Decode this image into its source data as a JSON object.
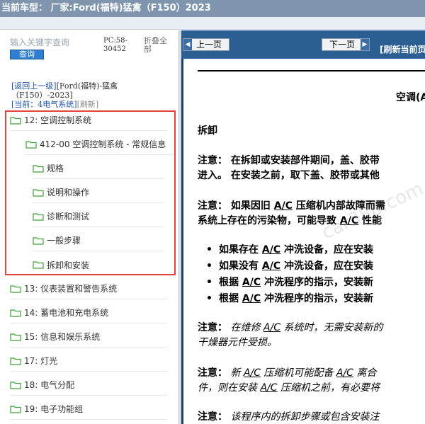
{
  "title": "当前车型： 厂家:Ford(福特)猛禽（F150）2023",
  "search": {
    "placeholder": "输入关键字查询",
    "button": "查询"
  },
  "pc": {
    "line1": "PC:58-",
    "line2": "30452"
  },
  "fold": {
    "label": "折叠全部"
  },
  "nav": {
    "back": "[返回上一级]",
    "vehicle": "[Ford(福特)-猛禽",
    "vehicle2": "（F150）-2023]",
    "current_prefix": "[当前：",
    "current": "4电气系统]",
    "refresh": "[刷新]"
  },
  "tree": [
    {
      "label": "12: 空调控制系统"
    },
    {
      "label": "412-00 空调控制系统 - 常规信息"
    },
    {
      "label": "规格"
    },
    {
      "label": "说明和操作"
    },
    {
      "label": "诊断和测试"
    },
    {
      "label": "一般步骤"
    },
    {
      "label": "拆卸和安装"
    },
    {
      "label": "13: 仪表装置和警告系统"
    },
    {
      "label": "14: 蓄电池和充电系统"
    },
    {
      "label": "15: 信息和娱乐系统"
    },
    {
      "label": "17: 灯光"
    },
    {
      "label": "18: 电气分配"
    },
    {
      "label": "19: 电子功能组"
    }
  ],
  "toolbar": {
    "prev": "上一页",
    "next": "下一页",
    "refresh": "[刷新当前页"
  },
  "doc": {
    "title": "空调(A",
    "heading": "拆卸",
    "note1_a": "注意： 在拆卸或安装部件期间，盖、胶带",
    "note1_b": "进入。 在安装之前，取下盖、胶带或其他",
    "note2_a_pre": "注意： 如果因旧 ",
    "ac": "A/C",
    "note2_a_post": " 压缩机内部故障而需",
    "note2_b_pre": "系统上存在的污染物，可能导致 ",
    "note2_b_post": " 性能",
    "b1_pre": "如果存在 ",
    "b1_post": " 冲洗设备，应在安装",
    "b2_pre": "如果没有 ",
    "b2_post": " 冲洗设备，应在安装",
    "b3_pre": "根据 ",
    "b3_post": " 冲洗程序的指示，安装新",
    "b4_pre": "根据 ",
    "b4_post": " 冲洗程序的指示，安装新",
    "note3_label": "注意：",
    "note3_a_pre": " 在维修 ",
    "note3_a_post": " 系统时，无需安装新的",
    "note3_b": "干燥器元件受损。",
    "note4_label": "注意：",
    "note4_a_pre": " 新 ",
    "note4_a_mid": " 压缩机可能配备 ",
    "note4_a_post": " 离合",
    "note4_b_pre": "件，则在安装 ",
    "note4_b_post": " 压缩机之前，有必要将",
    "note5_label": "注意：",
    "note5_a": " 该程序内的拆卸步骤或包含安装注",
    "watermark": "car388.com"
  },
  "colors": {
    "accent": "#2b5e92",
    "highlight": "#e0443c",
    "folder": "#4caf50"
  }
}
